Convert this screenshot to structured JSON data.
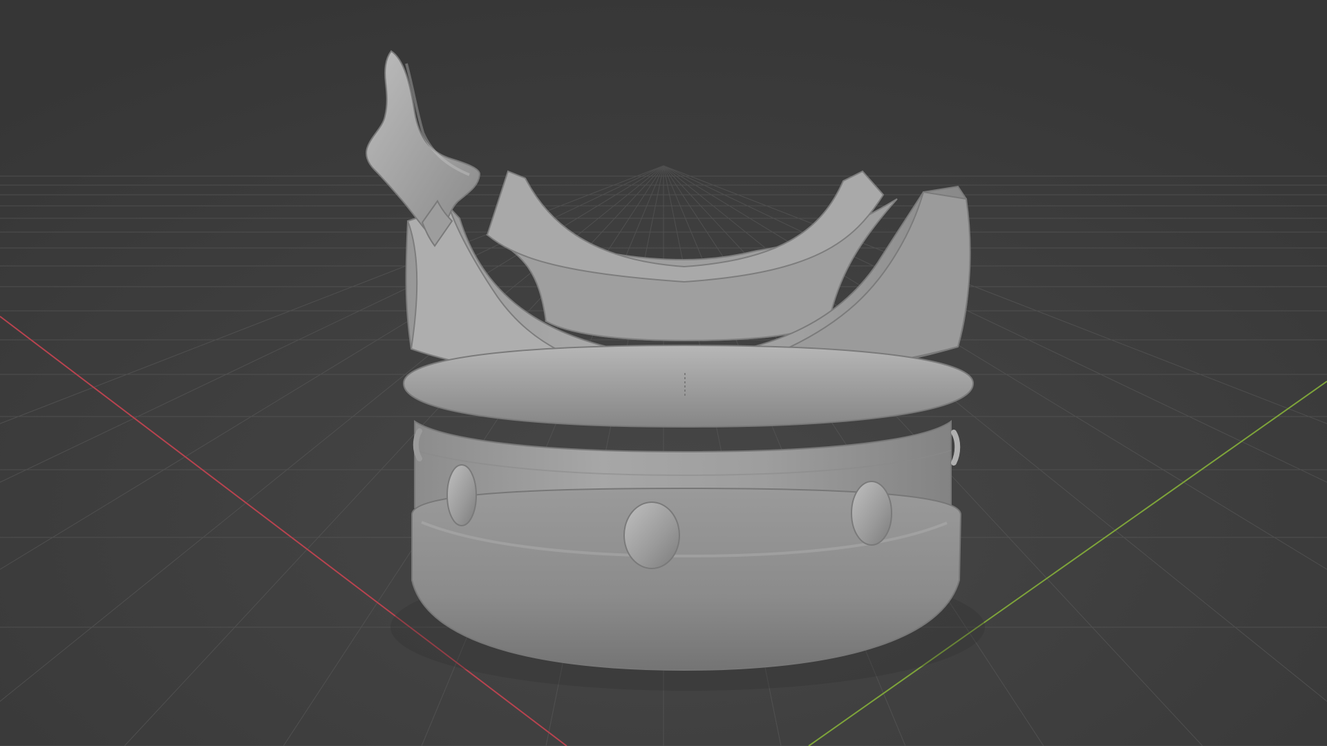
{
  "viewport": {
    "mode": "solid-shading",
    "background_color": "#3d3d3d",
    "grid_color": "#5a5a5a",
    "x_axis_color": "#b8434f",
    "y_axis_color": "#7ea43a"
  },
  "scene": {
    "object": "crown-mesh",
    "material_color": "#8f8f8f",
    "origin_marker": "object-origin"
  }
}
